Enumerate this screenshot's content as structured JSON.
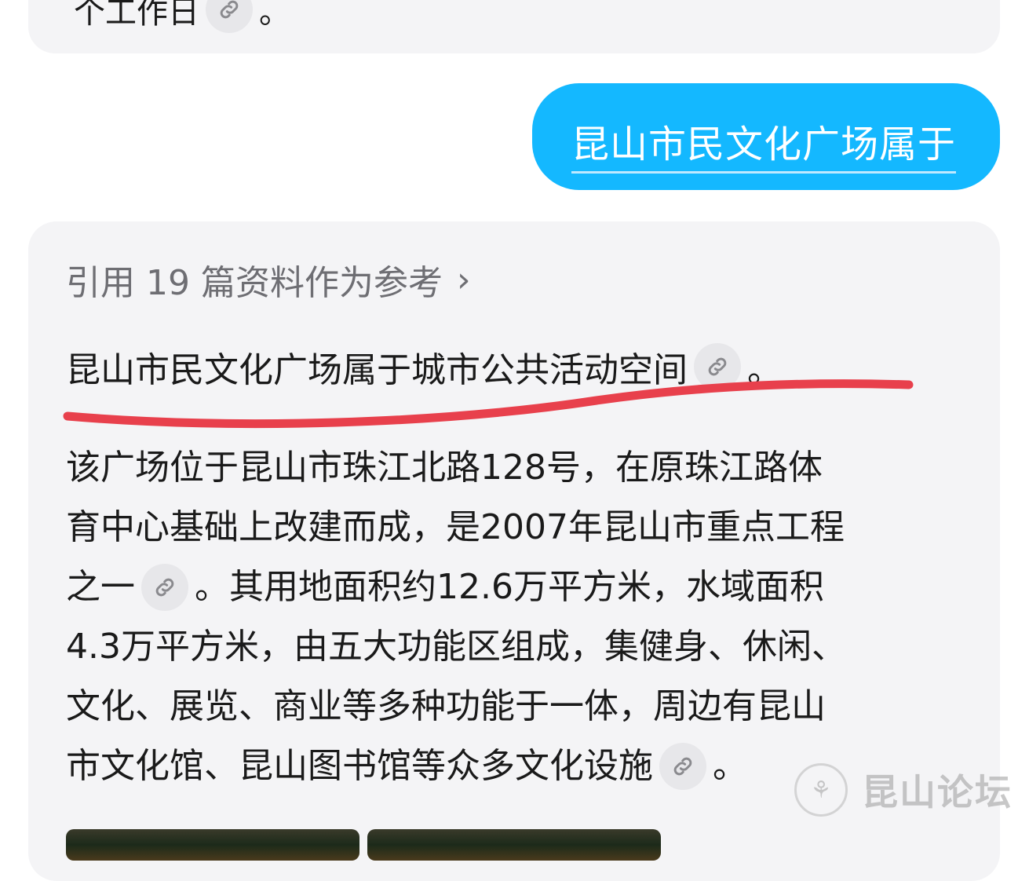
{
  "previous_answer": {
    "text_tail": "个工作日",
    "end_punct": "。"
  },
  "user_query": {
    "text": "昆山市民文化广场属于"
  },
  "answer": {
    "references_label": "引用 19 篇资料作为参考",
    "references_chevron": "›",
    "headline": "昆山市民文化广场属于城市公共活动空间",
    "headline_end": "。",
    "paragraph_lines": [
      "该广场位于昆山市珠江北路128号，在原珠江路体",
      "育中心基础上改建而成，是2007年昆山市重点工程",
      "之一",
      "。其用地面积约12.6万平方米，水域面积",
      "4.3万平方米，由五大功能区组成，集健身、休闲、",
      "文化、展览、商业等多种功能于一体，周边有昆山",
      "市文化馆、昆山图书馆等众多文化设施",
      "。"
    ]
  },
  "watermark": {
    "text": "昆山论坛"
  },
  "colors": {
    "user_bubble": "#14b8ff",
    "card_bg": "#f4f4f6",
    "annotation_stroke": "#e8404c",
    "link_chip": "#e7e7ea"
  },
  "icons": {
    "citation": "link-icon",
    "chevron": "chevron-right-icon",
    "seal": "forum-seal-icon"
  }
}
